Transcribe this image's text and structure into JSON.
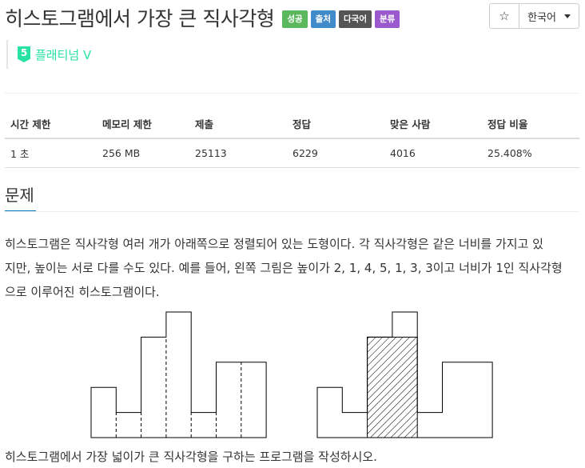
{
  "title": "히스토그램에서 가장 큰 직사각형",
  "labels": {
    "success": "성공",
    "source": "출처",
    "multilang": "다국어",
    "category": "분류"
  },
  "actions": {
    "star": "☆",
    "language": "한국어"
  },
  "tier": {
    "number": "5",
    "name": "플래티넘 V",
    "color": "#27e2a4"
  },
  "info_table": {
    "headers": [
      "시간 제한",
      "메모리 제한",
      "제출",
      "정답",
      "맞은 사람",
      "정답 비율"
    ],
    "row": [
      "1 초",
      "256 MB",
      "25113",
      "6229",
      "4016",
      "25.408%"
    ]
  },
  "section_title": "문제",
  "description": [
    "히스토그램은 직사각형 여러 개가 아래쪽으로 정렬되어 있는 도형이다. 각 직사각형은 같은 너비를 가지고 있",
    "지만, 높이는 서로 다를 수도 있다. 예를 들어, 왼쪽 그림은 높이가 2, 1, 4, 5, 1, 3, 3이고 너비가 1인 직사각형",
    "으로 이루어진 히스토그램이다."
  ],
  "figure": {
    "heights": [
      2,
      1,
      4,
      5,
      1,
      3,
      3
    ],
    "largest": {
      "start": 2,
      "end": 3,
      "height": 4
    }
  },
  "task": "히스토그램에서 가장 넓이가 큰 직사각형을 구하는 프로그램을 작성하시오."
}
